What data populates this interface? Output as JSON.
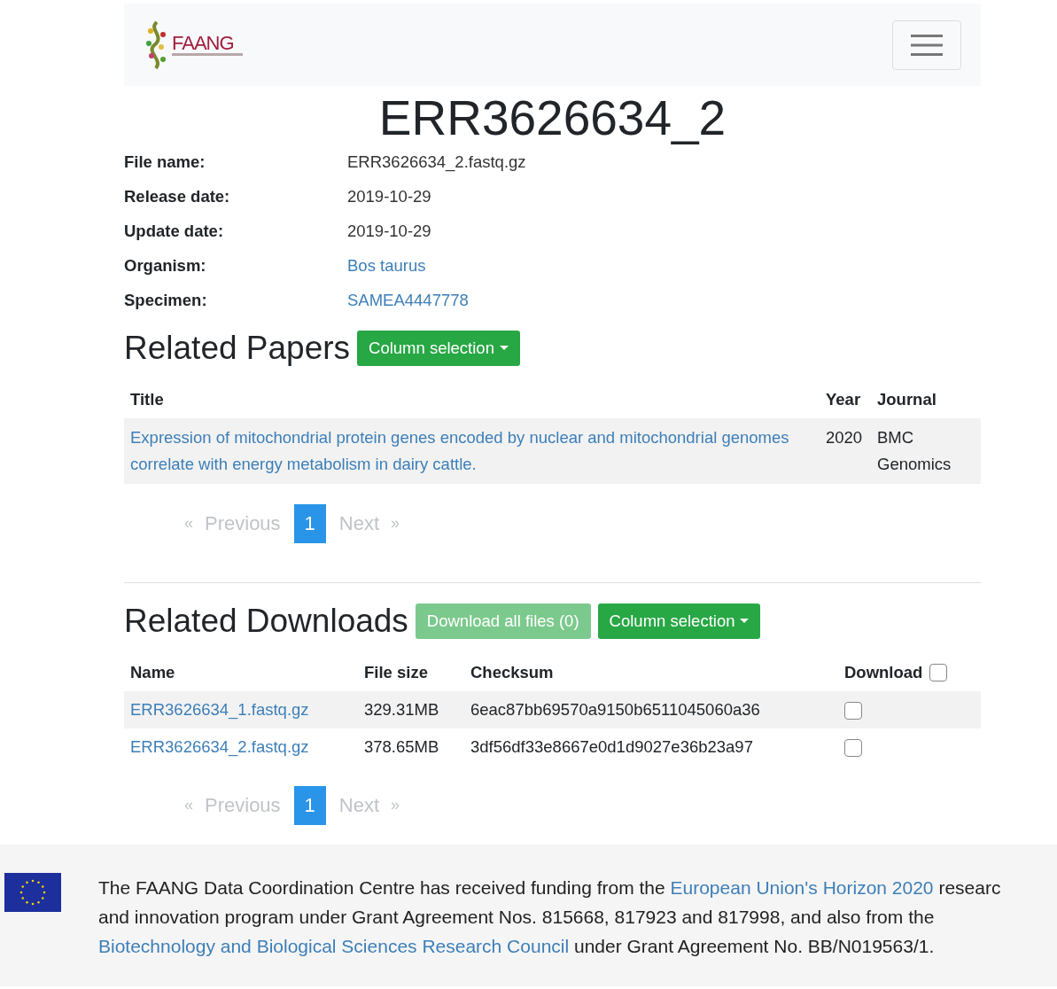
{
  "navbar": {
    "logo_text": "FAANG"
  },
  "title": "ERR3626634_2",
  "details": [
    {
      "label": "File name:",
      "value": "ERR3626634_2.fastq.gz",
      "link": false
    },
    {
      "label": "Release date:",
      "value": "2019-10-29",
      "link": false
    },
    {
      "label": "Update date:",
      "value": "2019-10-29",
      "link": false
    },
    {
      "label": "Organism:",
      "value": "Bos taurus",
      "link": true
    },
    {
      "label": "Specimen:",
      "value": "SAMEA4447778",
      "link": true
    }
  ],
  "papers": {
    "heading": "Related Papers",
    "column_button": "Column selection",
    "columns": [
      "Title",
      "Year",
      "Journal"
    ],
    "rows": [
      {
        "title": "Expression of mitochondrial protein genes encoded by nuclear and mitochondrial genomes correlate with energy metabolism in dairy cattle.",
        "year": "2020",
        "journal": "BMC Genomics"
      }
    ],
    "pagination": [
      {
        "label": "«",
        "kind": "arrow",
        "selected": false
      },
      {
        "label": "Previous",
        "kind": "text",
        "selected": false
      },
      {
        "label": "1",
        "kind": "page",
        "selected": true
      },
      {
        "label": "Next",
        "kind": "text",
        "selected": false
      },
      {
        "label": "»",
        "kind": "arrow",
        "selected": false
      }
    ]
  },
  "downloads": {
    "heading": "Related Downloads",
    "download_all": {
      "label": "Download all files (0)",
      "disabled": true
    },
    "column_button": "Column selection",
    "columns": [
      "Name",
      "File size",
      "Checksum",
      "Download"
    ],
    "select_all_checked": false,
    "rows": [
      {
        "name": "ERR3626634_1.fastq.gz",
        "size": "329.31MB",
        "checksum": "6eac87bb69570a9150b6511045060a36",
        "checked": false
      },
      {
        "name": "ERR3626634_2.fastq.gz",
        "size": "378.65MB",
        "checksum": "3df56df33e8667e0d1d9027e36b23a97",
        "checked": false
      }
    ],
    "pagination": [
      {
        "label": "«",
        "kind": "arrow",
        "selected": false
      },
      {
        "label": "Previous",
        "kind": "text",
        "selected": false
      },
      {
        "label": "1",
        "kind": "page",
        "selected": true
      },
      {
        "label": "Next",
        "kind": "text",
        "selected": false
      },
      {
        "label": "»",
        "kind": "arrow",
        "selected": false
      }
    ]
  },
  "footer": {
    "lines": [
      [
        {
          "text": "The FAANG Data Coordination Centre has received funding from the ",
          "link": false
        },
        {
          "text": "European Union's Horizon 2020",
          "link": true
        },
        {
          "text": " researc",
          "link": false
        }
      ],
      [
        {
          "text": "and innovation program under Grant Agreement Nos. 815668, 817923 and 817998, and also from the",
          "link": false
        }
      ],
      [
        {
          "text": "Biotechnology and Biological Sciences Research Council",
          "link": true
        },
        {
          "text": " under Grant Agreement No. BB/N019563/1.",
          "link": false
        }
      ]
    ]
  }
}
